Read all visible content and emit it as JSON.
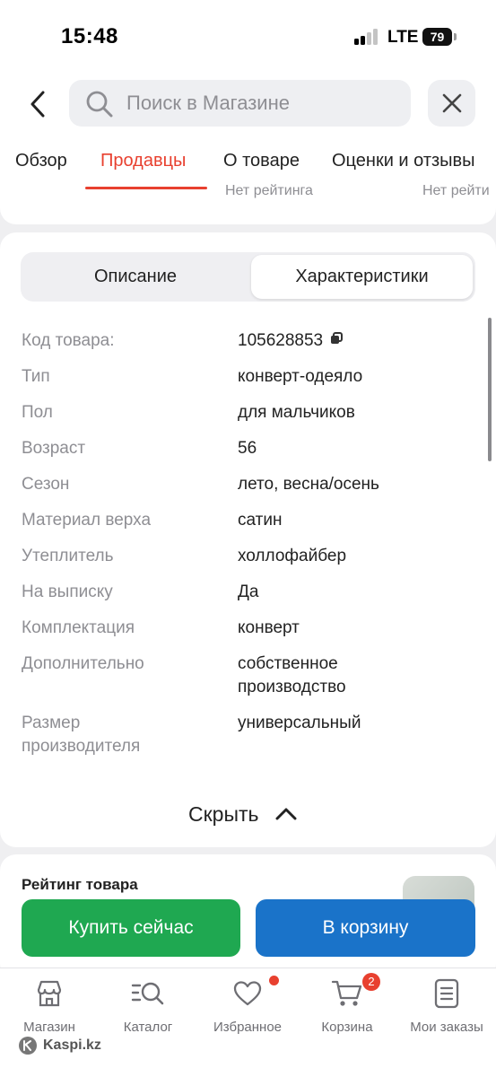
{
  "status_bar": {
    "time": "15:48",
    "network": "LTE",
    "battery": "79"
  },
  "header": {
    "search_placeholder": "Поиск в Магазине",
    "tabs": [
      {
        "label": "Обзор",
        "sub": ""
      },
      {
        "label": "Продавцы",
        "sub": ""
      },
      {
        "label": "О товаре",
        "sub": "Нет рейтинга"
      },
      {
        "label": "Оценки и отзывы",
        "sub": "Нет рейти"
      }
    ],
    "active_tab": "Продавцы"
  },
  "segmented": {
    "description": "Описание",
    "characteristics": "Характеристики",
    "selected": "Характеристики"
  },
  "specs": [
    {
      "label": "Код товара:",
      "value": "105628853"
    },
    {
      "label": "Тип",
      "value": "конверт-одеяло"
    },
    {
      "label": "Пол",
      "value": "для мальчиков"
    },
    {
      "label": "Возраст",
      "value": "56"
    },
    {
      "label": "Сезон",
      "value": "лето, весна/осень"
    },
    {
      "label": "Материал верха",
      "value": "сатин"
    },
    {
      "label": "Утеплитель",
      "value": "холлофайбер"
    },
    {
      "label": "На выписку",
      "value": "Да"
    },
    {
      "label": "Комплектация",
      "value": "конверт"
    },
    {
      "label": "Дополнительно",
      "value": "собственное производство"
    },
    {
      "label": "Размер производителя",
      "value": "универсальный"
    }
  ],
  "hide_label": "Скрыть",
  "rating_title": "Рейтинг товара",
  "actions": {
    "buy_now": "Купить сейчас",
    "to_cart": "В корзину"
  },
  "nav": [
    {
      "label": "Магазин",
      "icon": "shop-icon"
    },
    {
      "label": "Каталог",
      "icon": "catalog-search-icon"
    },
    {
      "label": "Избранное",
      "icon": "heart-icon"
    },
    {
      "label": "Корзина",
      "icon": "cart-icon",
      "badge": "2"
    },
    {
      "label": "Мои заказы",
      "icon": "orders-icon"
    }
  ],
  "watermark": "Kaspi.kz",
  "colors": {
    "accent": "#e8402f",
    "buy": "#1fa851",
    "cart": "#1a73c9"
  }
}
